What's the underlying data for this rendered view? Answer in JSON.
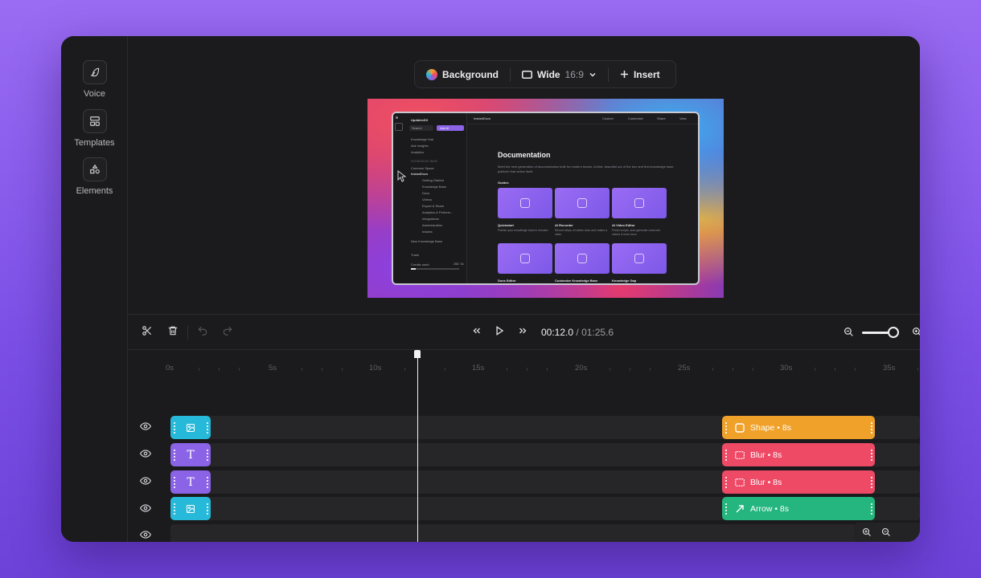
{
  "sidebar": {
    "items": [
      {
        "label": "Voice",
        "icon": "feather-icon"
      },
      {
        "label": "Templates",
        "icon": "layout-icon"
      },
      {
        "label": "Elements",
        "icon": "shapes-icon"
      }
    ]
  },
  "toolbar": {
    "background_label": "Background",
    "layout_label": "Wide",
    "ratio_label": "16:9",
    "insert_label": "Insert"
  },
  "preview": {
    "app_name": "UpdatesDX",
    "search_label": "Search",
    "ask_label": "Ask AI",
    "tab_label": "InstantDocs",
    "custom_label": "Custom",
    "customize_label": "Customize",
    "share_label": "Share",
    "view_label": "View",
    "nav": [
      "Knowledge Hub",
      "Ask Insights",
      "Analytics"
    ],
    "section_label": "KNOWLEDGE BASE",
    "kb_items": [
      "Common Space",
      "InstantDocs",
      "Getting Started",
      "Knowledge Base",
      "Docs",
      "Videos",
      "Export & Share",
      "Analytics & Perform...",
      "Integrations",
      "Administration",
      "Insides"
    ],
    "new_kb": "New Knowledge Base",
    "trash": "Trash",
    "credits_label": "Credits used",
    "credits_value": "288 / 3k",
    "title": "Documentation",
    "description": "Meet the next generation of documentation built for modern teams. AI-first, beautiful out of the box and first knowledge base platform that writes itself.",
    "guides_label": "Guides",
    "cards": [
      {
        "title": "Quickstart",
        "sub": "Publish your knowledge base in minutes"
      },
      {
        "title": "AI Recorder",
        "sub": "Record steps, AI writes docs and makes a video"
      },
      {
        "title": "AI Video Editor",
        "sub": "Polish scripts, auto-generate voiceover videos & more docs"
      },
      {
        "title": "Docs Editor",
        "sub": ""
      },
      {
        "title": "Customize Knowledge Base",
        "sub": ""
      },
      {
        "title": "Knowledge Gap",
        "sub": ""
      }
    ]
  },
  "playback": {
    "current_time": "00:12.0",
    "separator": " / ",
    "duration": "01:25.6"
  },
  "ruler_labels": [
    "0s",
    "5s",
    "10s",
    "15s",
    "20s",
    "25s",
    "30s",
    "35s"
  ],
  "clips": {
    "shape": "Shape • 8s",
    "blur1": "Blur • 8s",
    "blur2": "Blur • 8s",
    "arrow": "Arrow • 8s"
  },
  "colors": {
    "cyan": "#27b9d9",
    "violet": "#8a63e6",
    "orange": "#f0a12a",
    "red": "#ee4a66",
    "green": "#25b57e"
  }
}
